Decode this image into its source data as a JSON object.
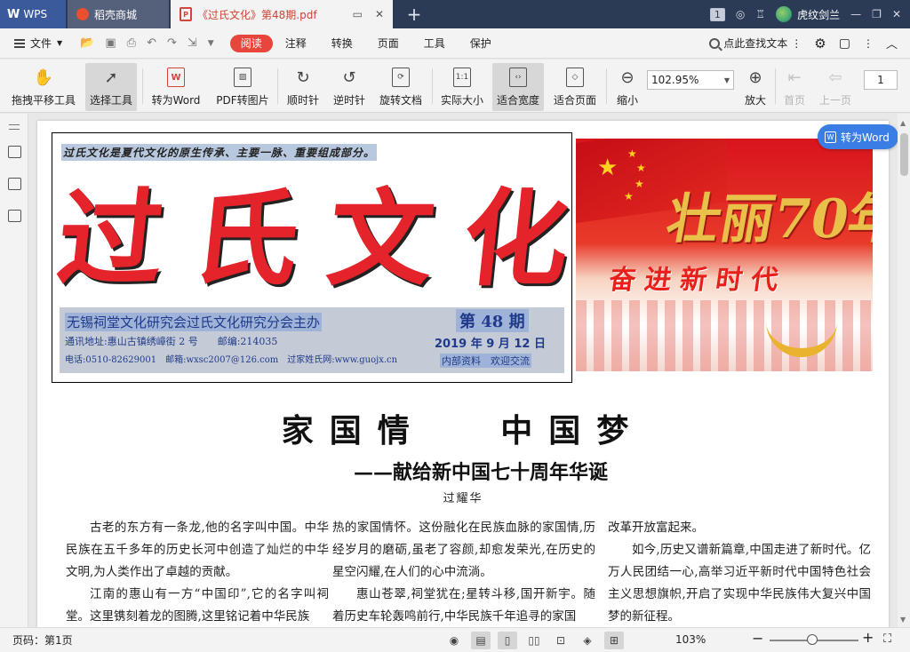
{
  "tabs": {
    "app": "WPS",
    "store": "稻壳商城",
    "doc": "《过氏文化》第48期.pdf",
    "window_count": "1",
    "user": "虎纹剑兰"
  },
  "menubar": {
    "file": "文件",
    "tabs": [
      "阅读",
      "注释",
      "转换",
      "页面",
      "工具",
      "保护"
    ],
    "find": "点此查找文本"
  },
  "toolbar": {
    "pan": "拖拽平移工具",
    "select": "选择工具",
    "to_word": "转为Word",
    "pdf_to_image": "PDF转图片",
    "rotate_cw": "顺时针",
    "rotate_ccw": "逆时针",
    "rotate_doc": "旋转文档",
    "actual_size": "实际大小",
    "fit_width": "适合宽度",
    "fit_page": "适合页面",
    "zoom_out": "缩小",
    "zoom_value": "102.95%",
    "zoom_in": "放大",
    "first_page": "首页",
    "prev_page": "上一页",
    "page_number": "1"
  },
  "float_button": {
    "to_word": "转为Word"
  },
  "masthead": {
    "motto": "过氏文化是夏代文化的原生传承、主要一脉、重要组成部分。",
    "title_chars": [
      "过",
      "氏",
      "文",
      "化"
    ],
    "sponsor": "无锡祠堂文化研究会过氏文化研究分会主办",
    "address": "通讯地址:惠山古镇绣嶂街 2 号　　邮编:214035",
    "contact": "电话:0510-82629001　邮箱:wxsc2007@126.com　过家姓氏网:www.guojx.cn",
    "issue": "第 48 期",
    "date": "2019 年 9 月 12 日",
    "note": "内部资料　欢迎交流"
  },
  "banner": {
    "seventy": "壮丽70年",
    "slogan": "奋进新时代"
  },
  "article": {
    "headline": "家国情　 中国梦",
    "subtitle": "——献给新中国七十周年华诞",
    "byline": "过耀华",
    "col1": [
      "古老的东方有一条龙,他的名字叫中国。中华民族在五千多年的历史长河中创造了灿烂的中华文明,为人类作出了卓越的贡献。",
      "江南的惠山有一方“中国印”,它的名字叫祠堂。这里镌刻着龙的图腾,这里铭记着中华民族"
    ],
    "col2": [
      "热的家国情怀。这份融化在民族血脉的家国情,历经岁月的磨砺,虽老了容颜,却愈发荣光,在历史的星空闪耀,在人们的心中流淌。",
      "惠山苍翠,祠堂犹在;星转斗移,国开新宇。随着历史车轮轰鸣前行,中华民族千年追寻的家国"
    ],
    "col3": [
      "改革开放富起来。",
      "如今,历史又谱新篇章,中国走进了新时代。亿万人民团结一心,高举习近平新时代中国特色社会主义思想旗帜,开启了实现中华民族伟大复兴中国梦的新征程。"
    ]
  },
  "statusbar": {
    "page_info": "页码：第1页",
    "zoom": "103%"
  },
  "colors": {
    "accent_red": "#e8463c",
    "title_red": "#e4232a",
    "info_blue": "#1f3a8a",
    "button_blue": "#3a7ee5"
  }
}
